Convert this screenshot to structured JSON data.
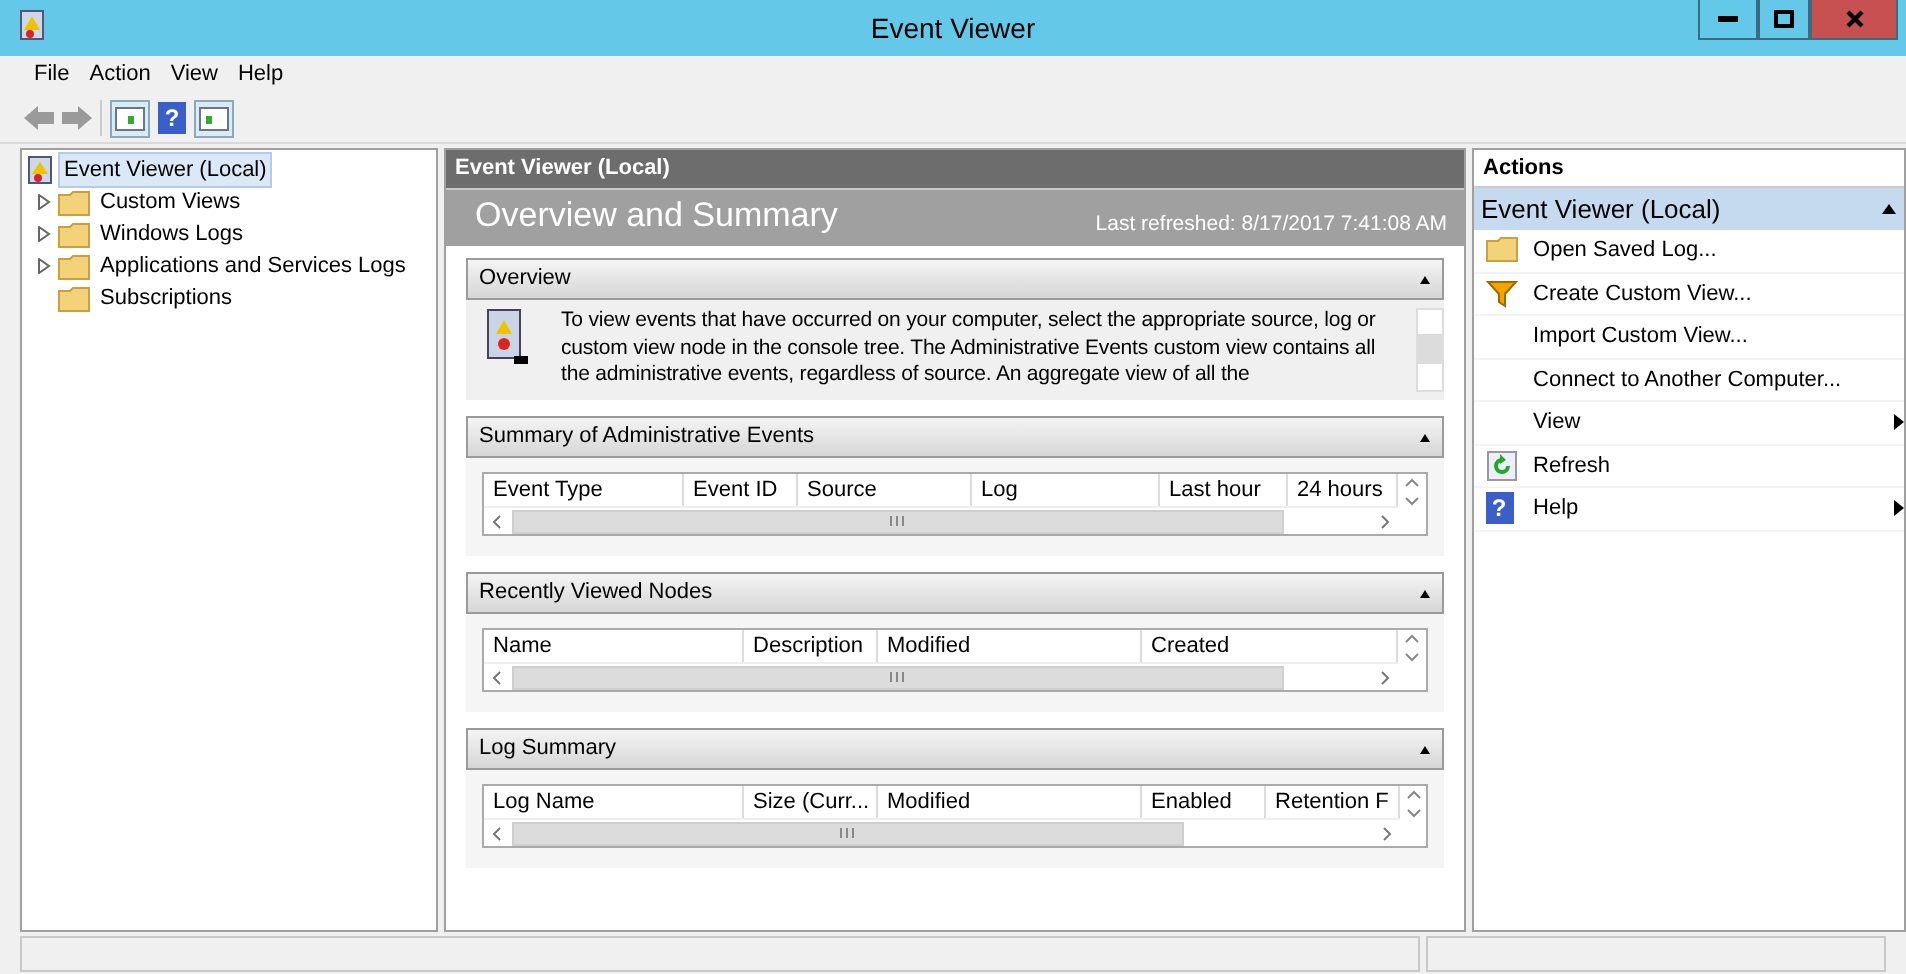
{
  "window": {
    "title": "Event Viewer"
  },
  "menu": [
    "File",
    "Action",
    "View",
    "Help"
  ],
  "toolbar": {
    "help_glyph": "?"
  },
  "tree": [
    {
      "label": "Event Viewer (Local)",
      "selected": true,
      "kind": "root",
      "children": [
        {
          "label": "Custom Views",
          "selected": false,
          "kind": "branch"
        },
        {
          "label": "Windows Logs",
          "selected": false,
          "kind": "branch"
        },
        {
          "label": "Applications and Services Logs",
          "selected": false,
          "kind": "branch"
        },
        {
          "label": "Subscriptions",
          "selected": false,
          "kind": "leaf"
        }
      ]
    }
  ],
  "center": {
    "header": "Event Viewer (Local)",
    "title": "Overview and Summary",
    "refreshed": "Last refreshed: 8/17/2017 7:41:08 AM",
    "sections": [
      {
        "title": "Overview",
        "kind": "text",
        "text": "To view events that have occurred on your computer, select the appropriate source, log or custom view node in the console tree. The Administrative Events custom view contains all the administrative events, regardless of source. An aggregate view of all the"
      },
      {
        "title": "Summary of Administrative Events",
        "kind": "table",
        "columns": [
          "Event Type",
          "Event ID",
          "Source",
          "Log",
          "Last hour",
          "24 hours"
        ]
      },
      {
        "title": "Recently Viewed Nodes",
        "kind": "table",
        "columns": [
          "Name",
          "Description",
          "Modified",
          "Created"
        ]
      },
      {
        "title": "Log Summary",
        "kind": "table",
        "columns": [
          "Log Name",
          "Size (Curr...",
          "Modified",
          "Enabled",
          "Retention F"
        ]
      }
    ]
  },
  "actions": {
    "header": "Actions",
    "group": "Event Viewer (Local)",
    "items": [
      {
        "label": "Open Saved Log...",
        "submenu": false
      },
      {
        "label": "Create Custom View...",
        "submenu": false
      },
      {
        "label": "Import Custom View...",
        "submenu": false
      },
      {
        "label": "Connect to Another Computer...",
        "submenu": false
      },
      {
        "label": "View",
        "submenu": true
      },
      {
        "label": "Refresh",
        "submenu": false
      },
      {
        "label": "Help",
        "submenu": true,
        "glyph": "?"
      }
    ]
  }
}
